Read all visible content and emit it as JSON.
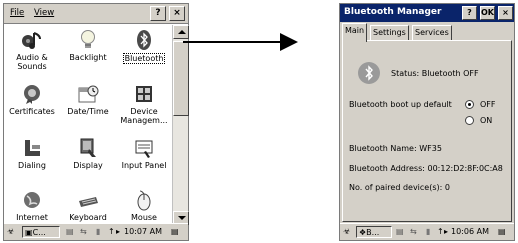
{
  "control_panel": {
    "menu": {
      "file": "File",
      "view": "View"
    },
    "buttons": {
      "help": "?",
      "close": "×"
    },
    "items": [
      {
        "label": "Audio & Sounds",
        "icon": "audio-sounds-icon"
      },
      {
        "label": "Backlight",
        "icon": "backlight-icon"
      },
      {
        "label": "Bluetooth",
        "icon": "bluetooth-icon"
      },
      {
        "label": "Certificates",
        "icon": "certificates-icon"
      },
      {
        "label": "Date/Time",
        "icon": "date-time-icon"
      },
      {
        "label": "Device Managem...",
        "icon": "device-management-icon"
      },
      {
        "label": "Dialing",
        "icon": "dialing-icon"
      },
      {
        "label": "Display",
        "icon": "display-icon"
      },
      {
        "label": "Input Panel",
        "icon": "input-panel-icon"
      },
      {
        "label": "Internet",
        "icon": "internet-icon"
      },
      {
        "label": "Keyboard",
        "icon": "keyboard-icon"
      },
      {
        "label": "Mouse",
        "icon": "mouse-icon"
      }
    ],
    "selected_item": "Bluetooth",
    "taskbar": {
      "task": "C...",
      "time": "10:07 AM"
    }
  },
  "bluetooth_manager": {
    "title": "Bluetooth Manager",
    "buttons": {
      "help": "?",
      "ok": "OK",
      "close": "×"
    },
    "tabs": [
      "Main",
      "Settings",
      "Services"
    ],
    "active_tab": "Main",
    "status_text": "Status: Bluetooth OFF",
    "boot_label": "Bluetooth boot up default",
    "boot_options": {
      "off": "OFF",
      "on": "ON"
    },
    "boot_selected": "OFF",
    "name_text": "Bluetooth Name: WF35",
    "address_text": "Bluetooth Address: 00:12:D2:8F:0C:A8",
    "paired_text": "No. of paired device(s): 0",
    "taskbar": {
      "task": "B...",
      "time": "10:06 AM"
    }
  }
}
